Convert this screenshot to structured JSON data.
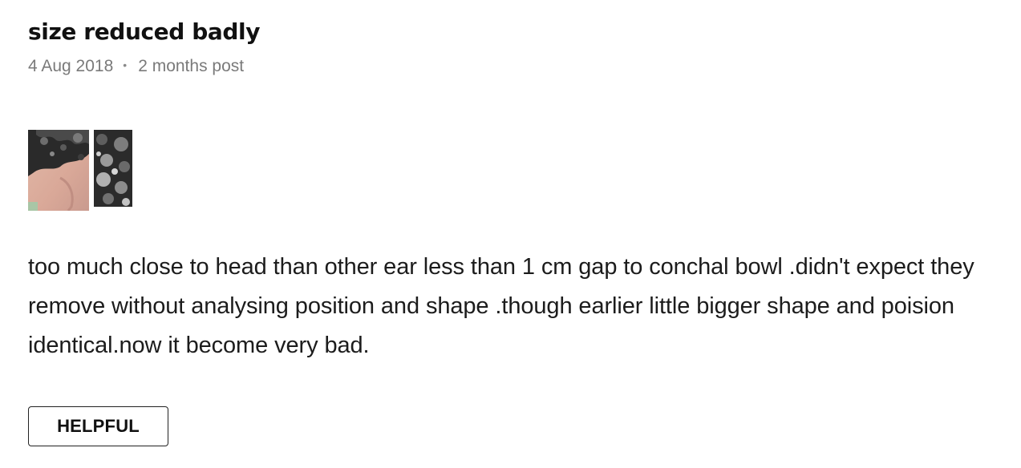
{
  "review": {
    "title": "size reduced badly",
    "date": "4 Aug 2018",
    "separator": "•",
    "post_time": "2 months post",
    "photos": [
      {
        "icon": "ear-photo-thumbnail"
      },
      {
        "icon": "hair-photo-thumbnail"
      }
    ],
    "body": "too much close to head than other ear less than 1 cm gap to conchal bowl .didn't expect they remove without analysing position and shape .though earlier little bigger shape and poision identical.now it become very bad.",
    "helpful_label": "HELPFUL"
  },
  "colors": {
    "title": "#111111",
    "meta": "#7a7a7a",
    "body": "#1c1c1c",
    "button_border": "#222222"
  }
}
